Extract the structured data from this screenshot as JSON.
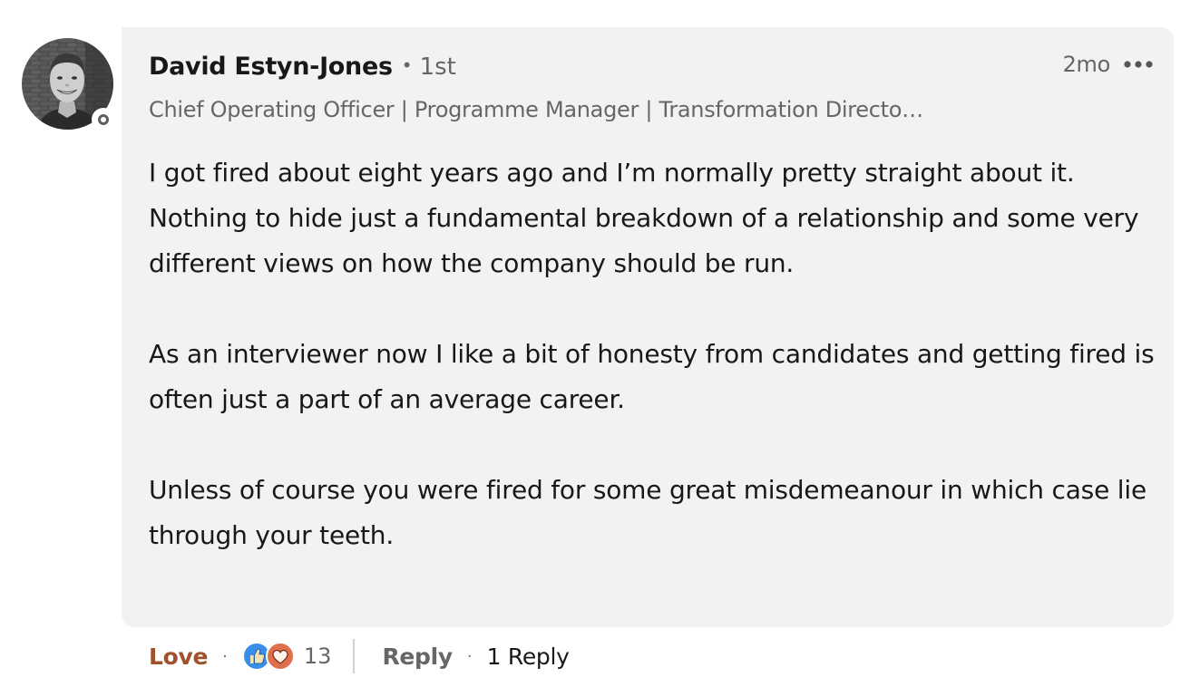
{
  "comment": {
    "author": {
      "name": "David Estyn-Jones",
      "connection_degree": "1st",
      "headline": "Chief Operating Officer | Programme Manager | Transformation Directo…",
      "avatar": "profile-photo",
      "presence": "offline"
    },
    "timestamp": "2mo",
    "more_icon": "ellipsis-icon",
    "body": [
      "I got fired about eight years ago and I’m normally pretty straight about it. Nothing to hide just a fundamental breakdown of a relationship and some very different views on how the company should be run.",
      "As an interviewer now I like a bit of honesty from candidates and getting fired is often just a part of an average career.",
      "Unless of course you were fired for some great misdemeanour in which case lie through your teeth."
    ]
  },
  "actions": {
    "reaction_label": "Love",
    "reaction_color": "#a0522d",
    "reaction_icons": [
      "like-icon",
      "love-icon"
    ],
    "reaction_count": "13",
    "reply_label": "Reply",
    "replies_text": "1 Reply"
  },
  "colors": {
    "bubble_bg": "#f2f2f2",
    "secondary_text": "#666666",
    "like_blue": "#378fe9",
    "love_red": "#df704d"
  }
}
